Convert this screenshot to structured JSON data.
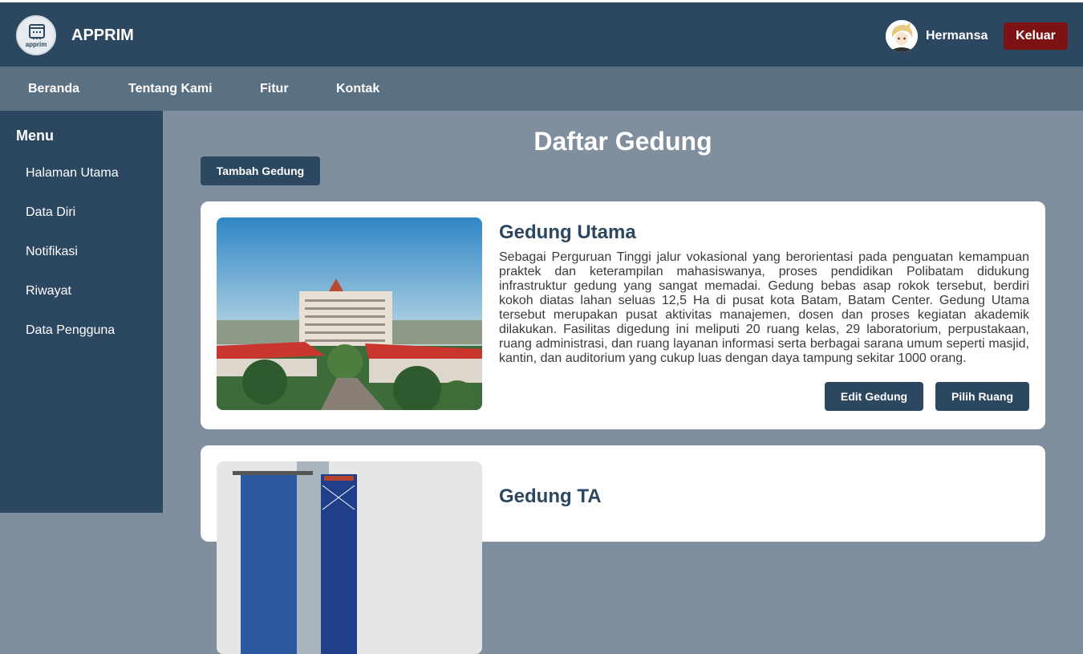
{
  "header": {
    "logo_text": "apprim",
    "app_title": "APPRIM",
    "username": "Hermansa",
    "logout_label": "Keluar"
  },
  "nav": {
    "items": [
      {
        "label": "Beranda"
      },
      {
        "label": "Tentang Kami"
      },
      {
        "label": "Fitur"
      },
      {
        "label": "Kontak"
      }
    ]
  },
  "sidebar": {
    "title": "Menu",
    "items": [
      {
        "label": "Halaman Utama"
      },
      {
        "label": "Data Diri"
      },
      {
        "label": "Notifikasi"
      },
      {
        "label": "Riwayat"
      },
      {
        "label": "Data Pengguna"
      }
    ]
  },
  "main": {
    "title": "Daftar Gedung",
    "add_label": "Tambah Gedung",
    "buildings": [
      {
        "name": "Gedung Utama",
        "description": "Sebagai Perguruan Tinggi jalur vokasional yang berorientasi pada penguatan kemampuan praktek dan keterampilan mahasiswanya, proses pendidikan Polibatam didukung infrastruktur gedung yang sangat memadai. Gedung bebas asap rokok tersebut, berdiri kokoh diatas lahan seluas 12,5 Ha di pusat kota Batam, Batam Center. Gedung Utama tersebut merupakan pusat aktivitas manajemen, dosen dan proses kegiatan akademik dilakukan. Fasilitas digedung ini meliputi 20 ruang kelas, 29 laboratorium, perpustakaan, ruang administrasi, dan ruang layanan informasi serta berbagai sarana umum seperti masjid, kantin, dan auditorium yang cukup luas dengan daya tampung sekitar 1000 orang.",
        "edit_label": "Edit Gedung",
        "pilih_label": "Pilih Ruang"
      },
      {
        "name": "Gedung TA"
      }
    ]
  },
  "colors": {
    "primary": "#2c4760",
    "navbar": "#5a7083",
    "background": "#7f8f9d",
    "danger": "#7c1214"
  }
}
